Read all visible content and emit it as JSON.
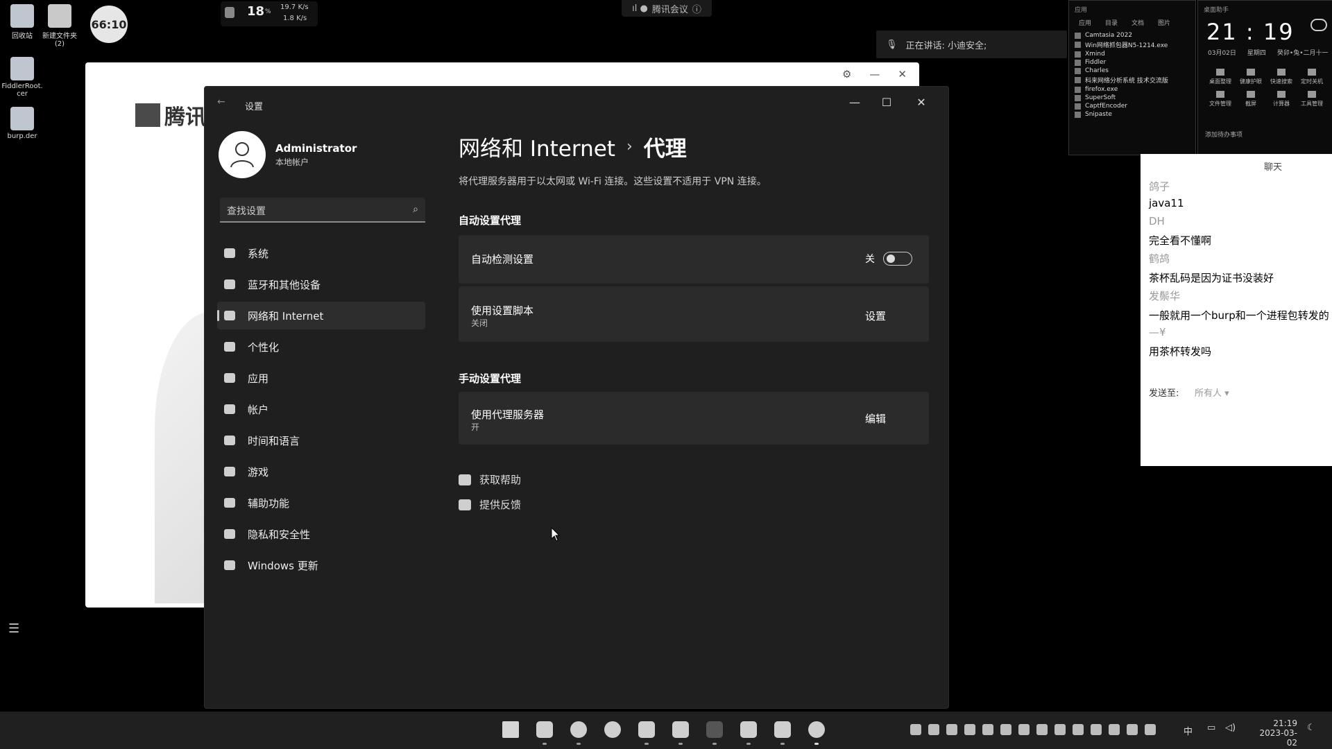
{
  "desktop": {
    "icons": [
      {
        "label": "回收站"
      },
      {
        "label": "新建文件夹\n(2)"
      },
      {
        "label": "FiddlerRoot.\ncer"
      },
      {
        "label": "burp.der"
      }
    ],
    "timer": "66:10",
    "cpu": "18",
    "cpu_unit": "%",
    "up_speed": "19.7 K/s",
    "down_speed": "1.8 K/s",
    "meeting_label": "腾讯会议",
    "speaking": "正在讲话: 小迪安全;",
    "tencent_logo": "腾讯"
  },
  "settings": {
    "window_title": "设置",
    "user_name": "Administrator",
    "user_type": "本地帐户",
    "search_placeholder": "查找设置",
    "nav": [
      {
        "label": "系统",
        "active": false
      },
      {
        "label": "蓝牙和其他设备",
        "active": false
      },
      {
        "label": "网络和 Internet",
        "active": true
      },
      {
        "label": "个性化",
        "active": false
      },
      {
        "label": "应用",
        "active": false
      },
      {
        "label": "帐户",
        "active": false
      },
      {
        "label": "时间和语言",
        "active": false
      },
      {
        "label": "游戏",
        "active": false
      },
      {
        "label": "辅助功能",
        "active": false
      },
      {
        "label": "隐私和安全性",
        "active": false
      },
      {
        "label": "Windows 更新",
        "active": false
      }
    ],
    "breadcrumb_parent": "网络和 Internet",
    "breadcrumb_sep": "›",
    "breadcrumb_page": "代理",
    "description": "将代理服务器用于以太网或 Wi-Fi 连接。这些设置不适用于 VPN 连接。",
    "auto_section": "自动设置代理",
    "auto_detect_label": "自动检测设置",
    "auto_detect_state": "关",
    "script_label": "使用设置脚本",
    "script_state": "关闭",
    "script_action": "设置",
    "manual_section": "手动设置代理",
    "proxy_label": "使用代理服务器",
    "proxy_state": "开",
    "proxy_action": "编辑",
    "help": "获取帮助",
    "feedback": "提供反馈"
  },
  "apps_panel": {
    "head": "应用",
    "tabs": [
      "应用",
      "目录",
      "文档",
      "图片"
    ],
    "items": [
      "Camtasia 2022",
      "Win网络抓包器N5-1214.exe",
      "Xmind",
      "Fiddler",
      "Charles",
      "科来网络分析系统 技术交流版",
      "firefox.exe",
      "SuperSoft",
      "CaptfEncoder",
      "Snipaste"
    ]
  },
  "clock_panel": {
    "head": "桌面助手",
    "time": "21 : 19",
    "date": "03月02日",
    "weekday": "星期四",
    "lunar": "癸卯•兔•二月十一",
    "tools": [
      "桌面整理",
      "健康护眼",
      "快速搜索",
      "定时关机",
      "文件管理",
      "截屏",
      "计算器",
      "工具管理"
    ],
    "todo": "添加待办事项"
  },
  "chat": {
    "title": "聊天",
    "messages": [
      {
        "name": "鸽子",
        "text": "java11"
      },
      {
        "name": "DH",
        "text": "完全看不懂啊"
      },
      {
        "name": "鹤鸪",
        "text": "茶杯乱码是因为证书没装好"
      },
      {
        "name": "发鬃华",
        "text": "一般就用一个burp和一个进程包转发的"
      },
      {
        "name": "—¥",
        "text": "用茶杯转发吗"
      }
    ],
    "send_to_label": "发送至:",
    "send_to_value": "所有人 ▾"
  },
  "taskbar": {
    "ime": "中",
    "time": "21:19",
    "date": "2023-03-02"
  }
}
